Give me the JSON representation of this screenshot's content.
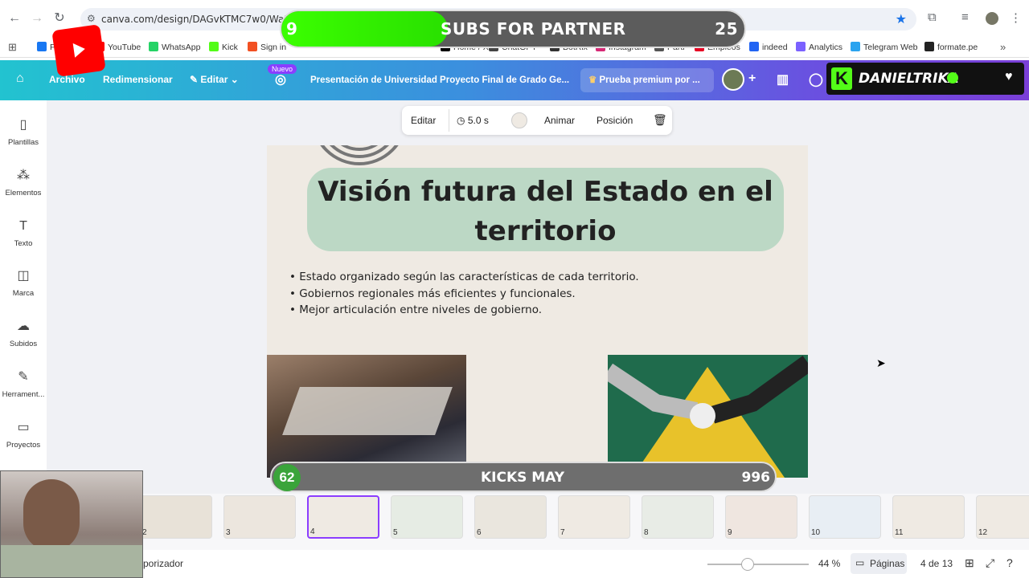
{
  "browser": {
    "url": "canva.com/design/DAGvKTMC7w0/WaLoJtLO",
    "bookmarks": [
      {
        "label": "Fa",
        "color": "#1877f2"
      },
      {
        "label": "YouTube",
        "color": "#ff0000"
      },
      {
        "label": "WhatsApp",
        "color": "#25d366"
      },
      {
        "label": "Kick",
        "color": "#53fc18"
      },
      {
        "label": "Sign in",
        "color": "#f25022"
      },
      {
        "label": "Home / X",
        "color": "#000000"
      },
      {
        "label": "ChatGPT",
        "color": "#444444"
      },
      {
        "label": "BotRix",
        "color": "#333333"
      },
      {
        "label": "Instagram",
        "color": "#d62976"
      },
      {
        "label": "Parti",
        "color": "#555555"
      },
      {
        "label": "Empleos",
        "color": "#e60023"
      },
      {
        "label": "indeed",
        "color": "#2164f3"
      },
      {
        "label": "Analytics",
        "color": "#7b61ff"
      },
      {
        "label": "Telegram Web",
        "color": "#2aa3ef"
      },
      {
        "label": "formate.pe",
        "color": "#222222"
      }
    ]
  },
  "overlay": {
    "subs_current": "9",
    "subs_label": "SUBS FOR PARTNER",
    "subs_goal": "25",
    "subs_progress": 0.36,
    "kicks_left": "62",
    "kicks_label": "KICKS MAY",
    "kicks_right": "996",
    "streamer": "DANIELTRIKA"
  },
  "header": {
    "archivo": "Archivo",
    "redimensionar": "Redimensionar",
    "editar": "Editar",
    "nuevo": "Nuevo",
    "title": "Presentación de Universidad Proyecto Final de Grado Ge...",
    "premium": "Prueba premium por ..."
  },
  "sidebar": {
    "items": [
      {
        "label": "Plantillas",
        "icon": "templates-icon"
      },
      {
        "label": "Elementos",
        "icon": "elements-icon"
      },
      {
        "label": "Texto",
        "icon": "text-icon"
      },
      {
        "label": "Marca",
        "icon": "brand-icon"
      },
      {
        "label": "Subidos",
        "icon": "uploads-icon"
      },
      {
        "label": "Herrament...",
        "icon": "tools-icon"
      },
      {
        "label": "Proyectos",
        "icon": "projects-icon"
      }
    ]
  },
  "toolbar": {
    "editar": "Editar",
    "duration": "5.0 s",
    "animar": "Animar",
    "posicion": "Posición"
  },
  "slide": {
    "title_line1": "Visión futura del Estado en el",
    "title_line2": "territorio",
    "bullets": [
      "Estado organizado según las características de cada territorio.",
      "Gobiernos regionales más eficientes y funcionales.",
      "Mejor articulación entre niveles de gobierno."
    ]
  },
  "thumbnails": [
    "2",
    "3",
    "4",
    "5",
    "6",
    "7",
    "8",
    "9",
    "10",
    "11",
    "12"
  ],
  "bottom": {
    "timer": "porizador",
    "zoom": "44 %",
    "pages": "Páginas",
    "page_count": "4 de 13"
  }
}
